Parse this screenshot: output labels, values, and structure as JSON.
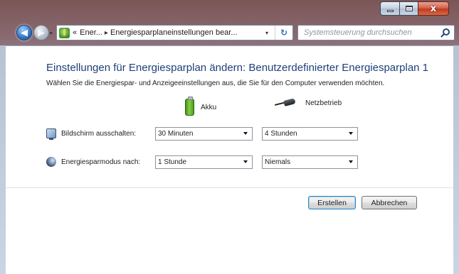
{
  "window": {
    "caption": {
      "minimize": "minimize",
      "maximize": "maximize",
      "close": "x"
    }
  },
  "navbar": {
    "history_glyph": "▾",
    "breadcrumb": {
      "prefix": "«",
      "items": [
        "Ener...",
        "Energiesparplaneinstellungen bear..."
      ],
      "separator": "▸"
    },
    "dropdown_glyph": "▾",
    "refresh_glyph": "↻",
    "search": {
      "placeholder": "Systemsteuerung durchsuchen",
      "value": ""
    }
  },
  "content": {
    "title": "Einstellungen für Energiesparplan ändern: Benutzerdefinierter Energiesparplan 1",
    "description": "Wählen Sie die Energiespar- und Anzeigeeinstellungen aus, die Sie für den Computer verwenden möchten.",
    "columns": {
      "battery": "Akku",
      "plugged_in": "Netzbetrieb"
    },
    "settings": [
      {
        "label": "Bildschirm ausschalten:",
        "battery_value": "30 Minuten",
        "plugged_value": "4 Stunden",
        "icon": "monitor-icon"
      },
      {
        "label": "Energiesparmodus nach:",
        "battery_value": "1 Stunde",
        "plugged_value": "Niemals",
        "icon": "moon-icon"
      }
    ],
    "buttons": {
      "create": "Erstellen",
      "cancel": "Abbrechen"
    }
  }
}
